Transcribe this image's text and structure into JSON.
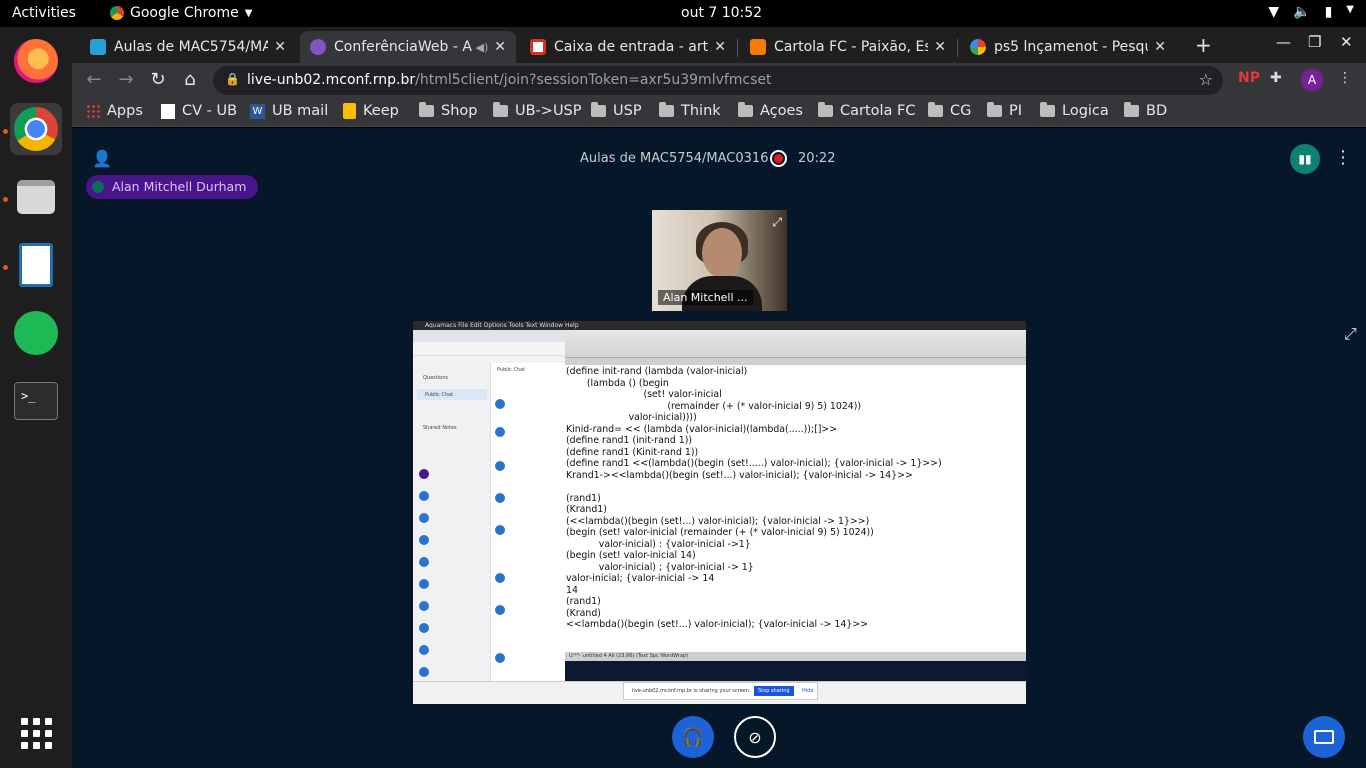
{
  "system_bar": {
    "activities": "Activities",
    "app_menu": "Google Chrome",
    "clock": "out 7  10:52"
  },
  "browser": {
    "tabs": [
      {
        "title": "Aulas de MAC5754/MA",
        "icon": "bbb-icon",
        "icon_color": "#2a9fd6",
        "active": false
      },
      {
        "title": "ConferênciaWeb - A",
        "icon": "conferenciaweb-icon",
        "icon_color": "#7e57c2",
        "active": true
      },
      {
        "title": "Caixa de entrada - arth",
        "icon": "gmail-icon",
        "icon_color": "#d93025",
        "active": false
      },
      {
        "title": "Cartola FC - Paixão, Esc",
        "icon": "cartola-icon",
        "icon_color": "#f57c00",
        "active": false
      },
      {
        "title": "ps5 lnçamenot - Pesqui",
        "icon": "google-icon",
        "icon_color": "#4285f4",
        "active": false
      }
    ],
    "url_host": "live-unb02.mconf.rnp.br",
    "url_path": "/html5client/join?sessionToken=axr5u39mlvfmcset",
    "profile_initial": "A",
    "bookmarks": [
      {
        "label": "Apps",
        "icon": "apps-grid-icon"
      },
      {
        "label": "CV - UB",
        "icon": "page-icon"
      },
      {
        "label": "UB mail",
        "icon": "word-icon"
      },
      {
        "label": "Keep",
        "icon": "keep-icon"
      },
      {
        "label": "Shop",
        "icon": "folder-icon"
      },
      {
        "label": "UB->USP",
        "icon": "folder-icon"
      },
      {
        "label": "USP",
        "icon": "folder-icon"
      },
      {
        "label": "Think",
        "icon": "folder-icon"
      },
      {
        "label": "Açoes",
        "icon": "folder-icon"
      },
      {
        "label": "Cartola FC",
        "icon": "folder-icon"
      },
      {
        "label": "CG",
        "icon": "folder-icon"
      },
      {
        "label": "PI",
        "icon": "folder-icon"
      },
      {
        "label": "Logica",
        "icon": "folder-icon"
      },
      {
        "label": "BD",
        "icon": "folder-icon"
      }
    ]
  },
  "meeting": {
    "title": "Aulas de MAC5754/MAC0316",
    "recording_time": "20:22",
    "talking_user": "Alan Mitchell Durham",
    "webcam_label": "Alan Mitchell ...",
    "colors": {
      "background": "#06172a",
      "primary": "#1b63d6",
      "talker": "#4a148c"
    }
  },
  "shared_screen": {
    "code_lines": [
      "(define init-rand (lambda (valor-inicial)",
      "       (lambda () (begin",
      "                          (set! valor-inicial",
      "                                  (remainder (+ (* valor-inicial 9) 5) 1024))",
      "                     valor-inicial))))",
      "Kinid-rand= << (lambda (valor-inicial)(lambda(.....));[]>>",
      "(define rand1 (init-rand 1))",
      "(define rand1 (Kinit-rand 1))",
      "(define rand1 <<(lambda()(begin (set!.....) valor-inicial); {valor-inicial -> 1}>>)",
      "Krand1-><<lambda()(begin (set!...) valor-inicial); {valor-inicial -> 14}>>",
      "",
      "(rand1)",
      "(Krand1)",
      "(<<lambda()(begin (set!...) valor-inicial); {valor-inicial -> 1}>>)",
      "(begin (set! valor-inicial (remainder (+ (* valor-inicial 9) 5) 1024))",
      "           valor-inicial) : {valor-inicial ->1}",
      "(begin (set! valor-inicial 14)",
      "           valor-inicial) ; {valor-inicial -> 1}",
      "valor-inicial; {valor-inicial -> 14",
      "14",
      "(rand1)",
      "(Krand)",
      "<<lambda()(begin (set!...) valor-inicial); {valor-inicial -> 14}>>"
    ],
    "menubar": "Aquamacs   File   Edit   Options   Tools   Text   Window   Help",
    "status_line": "U:**-  untitled 4     All (23,66)   (Text Spc WordWrap)",
    "share_notice": "live-unb02.mconf.rnp.br is sharing your screen.",
    "stop_sharing": "Stop sharing",
    "hide": "Hide",
    "chat_title": "Public Chat",
    "sidebar_items": [
      "Questions",
      "Public Chat",
      "Shared Notes"
    ]
  }
}
